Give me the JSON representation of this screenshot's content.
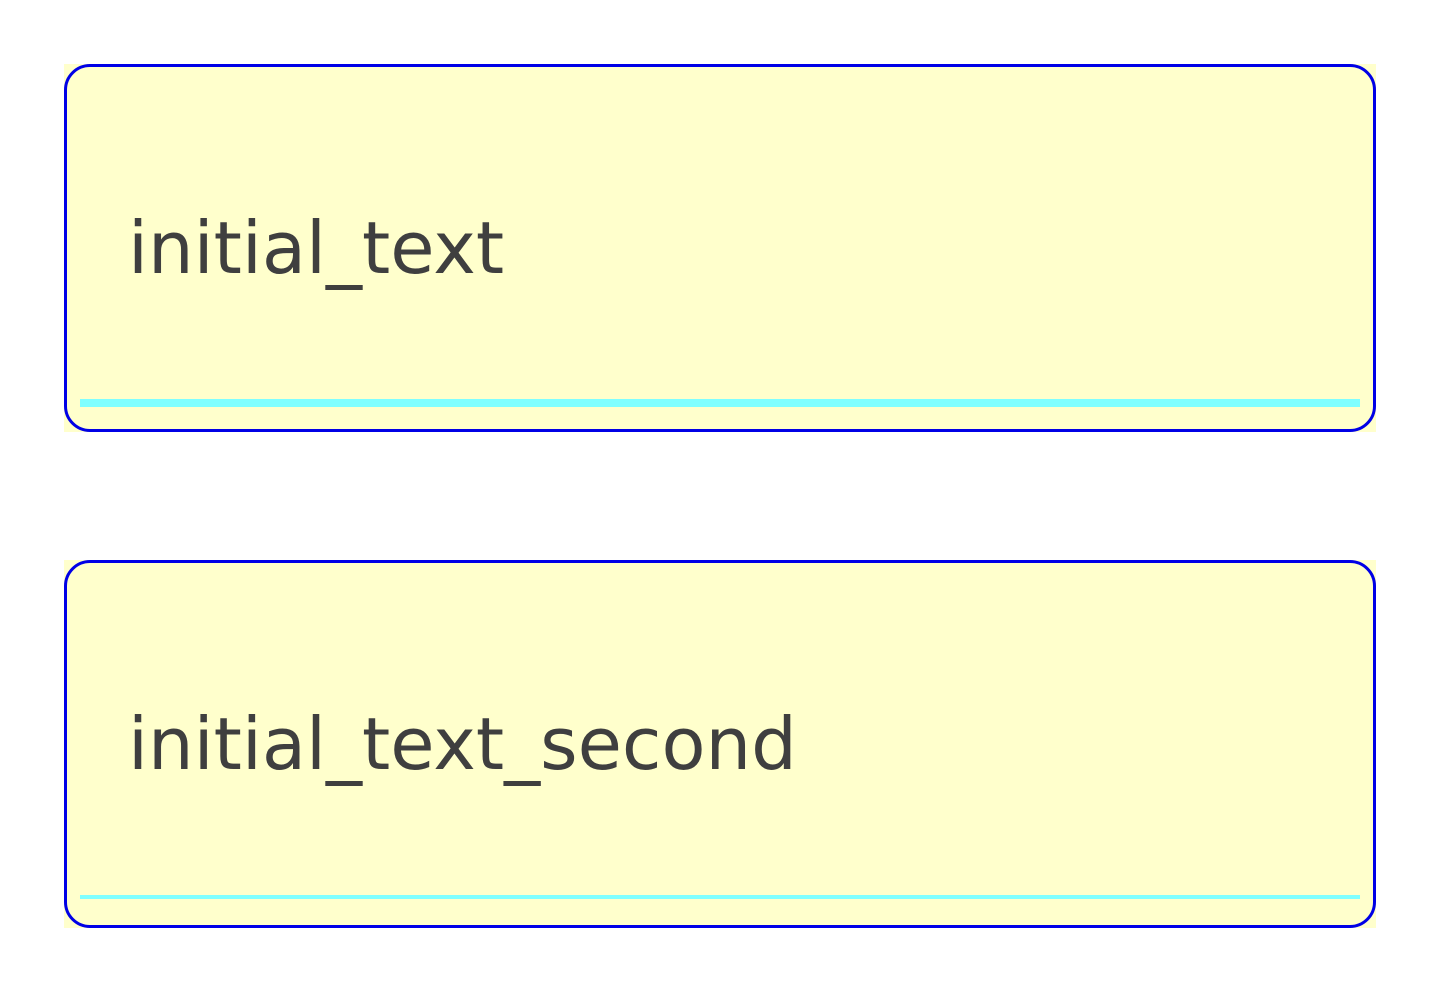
{
  "fields": [
    {
      "value": "initial_text",
      "focused": true
    },
    {
      "value": "initial_text_second",
      "focused": false
    }
  ],
  "colors": {
    "field_background": "#ffffcc",
    "field_border": "#0000e6",
    "underline": "#7fffff",
    "text": "#3f3f3f"
  }
}
